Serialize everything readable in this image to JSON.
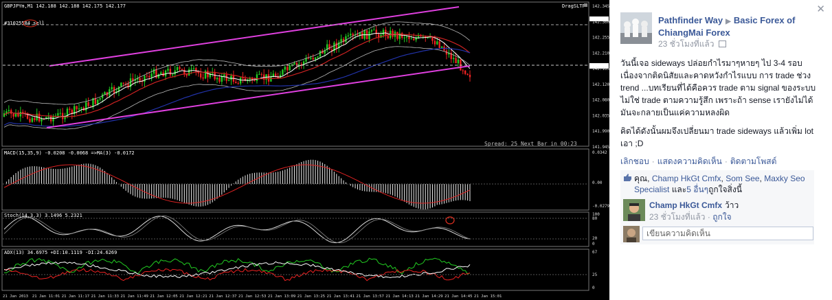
{
  "chart": {
    "symbol_line": "GBPJPYm,M1  142.188 142.188 142.175 142.177",
    "order_label": "#31025584 sell",
    "ea_label": "DragSLTP",
    "status": "Spread: 25   Next Bar in 00:23",
    "price_ticks": [
      "142.345",
      "142.300",
      "142.255",
      "142.210",
      "142.165",
      "142.120",
      "142.080",
      "142.035",
      "141.990",
      "141.945"
    ],
    "macd_label": "MACD(15,35,9) -0.0208 -0.0068  =>MA(3) -0.0172",
    "macd_ticks": [
      "0.0342",
      "0.00",
      "-0.0279"
    ],
    "stoch_label": "Stoch(14,3,3) 3.1496 5.2321",
    "stoch_ticks": [
      "100",
      "80",
      "20",
      "0"
    ],
    "adx_label": "ADX(13) 34.6975 +DI:10.1119 -DI:24.6269",
    "adx_ticks": [
      "67",
      "25",
      "0"
    ],
    "time_ticks": [
      "21 Jan 2013",
      "21 Jan 11:01",
      "21 Jan 11:17",
      "21 Jan 11:33",
      "21 Jan 11:49",
      "21 Jan 12:05",
      "21 Jan 12:21",
      "21 Jan 12:37",
      "21 Jan 12:53",
      "21 Jan 13:09",
      "21 Jan 13:25",
      "21 Jan 13:41",
      "21 Jan 13:57",
      "21 Jan 14:13",
      "21 Jan 14:29",
      "21 Jan 14:45",
      "21 Jan 15:01"
    ]
  },
  "post": {
    "author": "Pathfinder Way",
    "target": "Basic Forex of ChiangMai Forex",
    "time": "23 ชั่วโมงที่แล้ว",
    "paragraph1": "วันนี้เจอ sideways ปล่อยกำไรมาๆหายๆ ไป 3-4 รอบ เนื่องจากติดนิสัยและคาดหวังกำไรแบบ การ trade ช่วง trend ...บทเรียนที่ได้คือควร trade ตาม signal ของระบบ ไม่ใช่ trade ตามความรู้สึก เพราะถ้า sense เรายังไม่ได้มันจะกลายเป็นแค่ความหลงผิด",
    "paragraph2": "คิดได้ดังนั้นผมจึงเปลี่ยนมา trade sideways แล้วเพิ่ม lot เอา ;D",
    "actions": [
      "เลิกชอบ",
      "แสดงความคิดเห็น",
      "ติดตามโพสต์"
    ],
    "likes": {
      "prefix": "คุณ, ",
      "name1": "Champ HkGt Cmfx",
      "sep1": ", ",
      "name2": "Som See",
      "sep2": ", ",
      "name3": "Maxky Seo Specialist",
      "and": " และ",
      "others": "5 อื่นๆ",
      "suffix": "ถูกใจสิ่งนี้"
    },
    "comment": {
      "author": "Champ HkGt Cmfx",
      "text": "ว้าว",
      "time": "23 ชั่วโมงที่แล้ว",
      "like": "ถูกใจ"
    },
    "write_placeholder": "เขียนความคิดเห็น"
  },
  "colors": {
    "channel": "#e040e0",
    "bull_candle": "#22cc22",
    "bear_candle": "#ee2222",
    "panel_link": "#3b5998"
  }
}
